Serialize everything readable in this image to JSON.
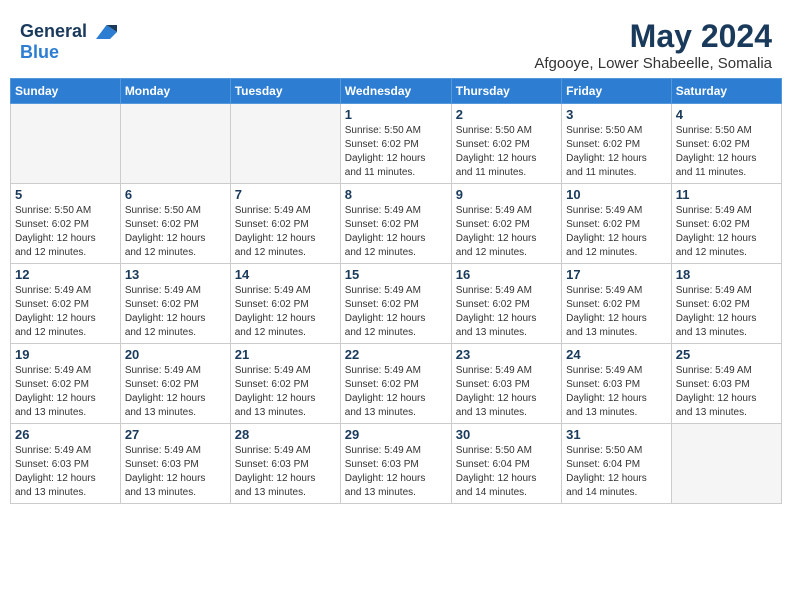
{
  "header": {
    "logo_line1": "General",
    "logo_line2": "Blue",
    "month": "May 2024",
    "location": "Afgooye, Lower Shabeelle, Somalia"
  },
  "weekdays": [
    "Sunday",
    "Monday",
    "Tuesday",
    "Wednesday",
    "Thursday",
    "Friday",
    "Saturday"
  ],
  "weeks": [
    [
      {
        "num": "",
        "info": ""
      },
      {
        "num": "",
        "info": ""
      },
      {
        "num": "",
        "info": ""
      },
      {
        "num": "1",
        "info": "Sunrise: 5:50 AM\nSunset: 6:02 PM\nDaylight: 12 hours\nand 11 minutes."
      },
      {
        "num": "2",
        "info": "Sunrise: 5:50 AM\nSunset: 6:02 PM\nDaylight: 12 hours\nand 11 minutes."
      },
      {
        "num": "3",
        "info": "Sunrise: 5:50 AM\nSunset: 6:02 PM\nDaylight: 12 hours\nand 11 minutes."
      },
      {
        "num": "4",
        "info": "Sunrise: 5:50 AM\nSunset: 6:02 PM\nDaylight: 12 hours\nand 11 minutes."
      }
    ],
    [
      {
        "num": "5",
        "info": "Sunrise: 5:50 AM\nSunset: 6:02 PM\nDaylight: 12 hours\nand 12 minutes."
      },
      {
        "num": "6",
        "info": "Sunrise: 5:50 AM\nSunset: 6:02 PM\nDaylight: 12 hours\nand 12 minutes."
      },
      {
        "num": "7",
        "info": "Sunrise: 5:49 AM\nSunset: 6:02 PM\nDaylight: 12 hours\nand 12 minutes."
      },
      {
        "num": "8",
        "info": "Sunrise: 5:49 AM\nSunset: 6:02 PM\nDaylight: 12 hours\nand 12 minutes."
      },
      {
        "num": "9",
        "info": "Sunrise: 5:49 AM\nSunset: 6:02 PM\nDaylight: 12 hours\nand 12 minutes."
      },
      {
        "num": "10",
        "info": "Sunrise: 5:49 AM\nSunset: 6:02 PM\nDaylight: 12 hours\nand 12 minutes."
      },
      {
        "num": "11",
        "info": "Sunrise: 5:49 AM\nSunset: 6:02 PM\nDaylight: 12 hours\nand 12 minutes."
      }
    ],
    [
      {
        "num": "12",
        "info": "Sunrise: 5:49 AM\nSunset: 6:02 PM\nDaylight: 12 hours\nand 12 minutes."
      },
      {
        "num": "13",
        "info": "Sunrise: 5:49 AM\nSunset: 6:02 PM\nDaylight: 12 hours\nand 12 minutes."
      },
      {
        "num": "14",
        "info": "Sunrise: 5:49 AM\nSunset: 6:02 PM\nDaylight: 12 hours\nand 12 minutes."
      },
      {
        "num": "15",
        "info": "Sunrise: 5:49 AM\nSunset: 6:02 PM\nDaylight: 12 hours\nand 12 minutes."
      },
      {
        "num": "16",
        "info": "Sunrise: 5:49 AM\nSunset: 6:02 PM\nDaylight: 12 hours\nand 13 minutes."
      },
      {
        "num": "17",
        "info": "Sunrise: 5:49 AM\nSunset: 6:02 PM\nDaylight: 12 hours\nand 13 minutes."
      },
      {
        "num": "18",
        "info": "Sunrise: 5:49 AM\nSunset: 6:02 PM\nDaylight: 12 hours\nand 13 minutes."
      }
    ],
    [
      {
        "num": "19",
        "info": "Sunrise: 5:49 AM\nSunset: 6:02 PM\nDaylight: 12 hours\nand 13 minutes."
      },
      {
        "num": "20",
        "info": "Sunrise: 5:49 AM\nSunset: 6:02 PM\nDaylight: 12 hours\nand 13 minutes."
      },
      {
        "num": "21",
        "info": "Sunrise: 5:49 AM\nSunset: 6:02 PM\nDaylight: 12 hours\nand 13 minutes."
      },
      {
        "num": "22",
        "info": "Sunrise: 5:49 AM\nSunset: 6:02 PM\nDaylight: 12 hours\nand 13 minutes."
      },
      {
        "num": "23",
        "info": "Sunrise: 5:49 AM\nSunset: 6:03 PM\nDaylight: 12 hours\nand 13 minutes."
      },
      {
        "num": "24",
        "info": "Sunrise: 5:49 AM\nSunset: 6:03 PM\nDaylight: 12 hours\nand 13 minutes."
      },
      {
        "num": "25",
        "info": "Sunrise: 5:49 AM\nSunset: 6:03 PM\nDaylight: 12 hours\nand 13 minutes."
      }
    ],
    [
      {
        "num": "26",
        "info": "Sunrise: 5:49 AM\nSunset: 6:03 PM\nDaylight: 12 hours\nand 13 minutes."
      },
      {
        "num": "27",
        "info": "Sunrise: 5:49 AM\nSunset: 6:03 PM\nDaylight: 12 hours\nand 13 minutes."
      },
      {
        "num": "28",
        "info": "Sunrise: 5:49 AM\nSunset: 6:03 PM\nDaylight: 12 hours\nand 13 minutes."
      },
      {
        "num": "29",
        "info": "Sunrise: 5:49 AM\nSunset: 6:03 PM\nDaylight: 12 hours\nand 13 minutes."
      },
      {
        "num": "30",
        "info": "Sunrise: 5:50 AM\nSunset: 6:04 PM\nDaylight: 12 hours\nand 14 minutes."
      },
      {
        "num": "31",
        "info": "Sunrise: 5:50 AM\nSunset: 6:04 PM\nDaylight: 12 hours\nand 14 minutes."
      },
      {
        "num": "",
        "info": ""
      }
    ]
  ]
}
